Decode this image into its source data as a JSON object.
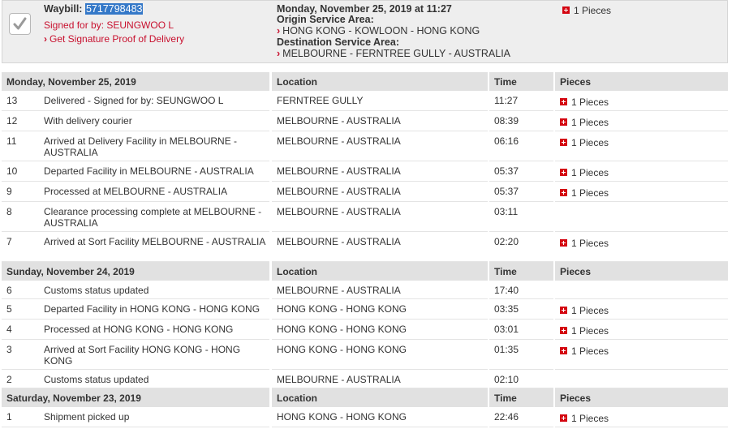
{
  "summary": {
    "waybill_label": "Waybill:",
    "waybill_number": "5717798483",
    "signed_for": "Signed for by: SEUNGWOO L",
    "proof_link": "Get Signature Proof of Delivery",
    "datetime": "Monday, November 25, 2019 at 11:27",
    "origin_label": "Origin Service Area:",
    "origin_value": "HONG KONG - KOWLOON - HONG KONG",
    "destination_label": "Destination Service Area:",
    "destination_value": "MELBOURNE - FERNTREE GULLY - AUSTRALIA",
    "pieces": "1 Pieces"
  },
  "columns": {
    "location": "Location",
    "time": "Time",
    "pieces": "Pieces"
  },
  "groups": [
    {
      "date": "Monday, November 25, 2019",
      "events": [
        {
          "num": "13",
          "desc": "Delivered - Signed for by: SEUNGWOO L",
          "location": "FERNTREE GULLY",
          "time": "11:27",
          "pieces": "1 Pieces"
        },
        {
          "num": "12",
          "desc": "With delivery courier",
          "location": "MELBOURNE - AUSTRALIA",
          "time": "08:39",
          "pieces": "1 Pieces"
        },
        {
          "num": "11",
          "desc": "Arrived at Delivery Facility in MELBOURNE - AUSTRALIA",
          "location": "MELBOURNE - AUSTRALIA",
          "time": "06:16",
          "pieces": "1 Pieces"
        },
        {
          "num": "10",
          "desc": "Departed Facility in MELBOURNE - AUSTRALIA",
          "location": "MELBOURNE - AUSTRALIA",
          "time": "05:37",
          "pieces": "1 Pieces"
        },
        {
          "num": "9",
          "desc": "Processed at MELBOURNE - AUSTRALIA",
          "location": "MELBOURNE - AUSTRALIA",
          "time": "05:37",
          "pieces": "1 Pieces"
        },
        {
          "num": "8",
          "desc": "Clearance processing complete at MELBOURNE - AUSTRALIA",
          "location": "MELBOURNE - AUSTRALIA",
          "time": "03:11",
          "pieces": ""
        },
        {
          "num": "7",
          "desc": "Arrived at Sort Facility MELBOURNE - AUSTRALIA",
          "location": "MELBOURNE - AUSTRALIA",
          "time": "02:20",
          "pieces": "1 Pieces"
        }
      ]
    },
    {
      "date": "Sunday, November 24, 2019",
      "events": [
        {
          "num": "6",
          "desc": "Customs status updated",
          "location": "MELBOURNE - AUSTRALIA",
          "time": "17:40",
          "pieces": ""
        },
        {
          "num": "5",
          "desc": "Departed Facility in HONG KONG - HONG KONG",
          "location": "HONG KONG - HONG KONG",
          "time": "03:35",
          "pieces": "1 Pieces"
        },
        {
          "num": "4",
          "desc": "Processed at HONG KONG - HONG KONG",
          "location": "HONG KONG - HONG KONG",
          "time": "03:01",
          "pieces": "1 Pieces"
        },
        {
          "num": "3",
          "desc": "Arrived at Sort Facility HONG KONG - HONG KONG",
          "location": "HONG KONG - HONG KONG",
          "time": "01:35",
          "pieces": "1 Pieces"
        },
        {
          "num": "2",
          "desc": "Customs status updated",
          "location": "MELBOURNE - AUSTRALIA",
          "time": "02:10",
          "pieces": ""
        }
      ]
    },
    {
      "date": "Saturday, November 23, 2019",
      "events": [
        {
          "num": "1",
          "desc": "Shipment picked up",
          "location": "HONG KONG - HONG KONG",
          "time": "22:46",
          "pieces": "1 Pieces"
        }
      ]
    }
  ],
  "colors": {
    "accent_red": "#c8102e",
    "header_gray": "#e1e1e1",
    "summary_bg": "#eeeeee",
    "selection_blue": "#3478c8"
  },
  "icons": {
    "status": "checkmark-icon",
    "pieces": "plus-square-icon",
    "link_arrow": "chevron-right-icon"
  }
}
